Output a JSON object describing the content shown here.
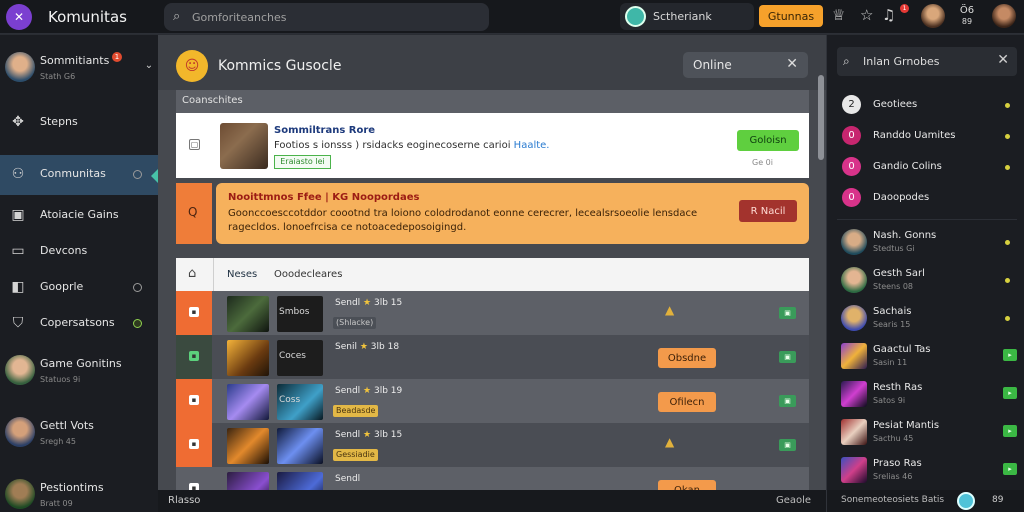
{
  "app": {
    "name": "Komunitas"
  },
  "topbar": {
    "search_placeholder": "Gomforiteanches",
    "user_name": "Sctheriank",
    "primary_button": "Gtunnas",
    "notif_count": "1",
    "coins_top": "Ö6",
    "coins_bottom": "89"
  },
  "sidebar": {
    "items": [
      {
        "label": "Sommitiants",
        "sub": "Stath G6",
        "badge": "1"
      },
      {
        "label": "Stepns"
      },
      {
        "label": "Conmunitas"
      },
      {
        "label": "Atoiacie Gains"
      },
      {
        "label": "Devcons"
      },
      {
        "label": "Gooprle"
      },
      {
        "label": "Copersatsons"
      },
      {
        "label": "Game Gonitins",
        "sub": "Statuos 9i"
      },
      {
        "label": "Gettl Vots",
        "sub": "Sregh 45"
      },
      {
        "label": "Pestiontims",
        "sub": "Bratt 09"
      }
    ]
  },
  "main": {
    "title": "Kommics Gusocle",
    "online_label": "Online",
    "card_header": "Coanschites",
    "post": {
      "name": "Sommiltrans Rore",
      "desc": "Footios s ionsss )  rsidacks  eoginecoserne carioi",
      "link": "Haalte.",
      "tag": "Eraiasto lei",
      "button": "Goloisn",
      "small": "Ge 0i"
    },
    "alert": {
      "icon": "Q",
      "title": "Nooittmnos Ffee | KG  Noopordaes",
      "line1": "Goonccoesccotddor  coootnd tra  loiono  colodrodanot  eonne  cerecrer, lecealsrsoeolie  lensdace",
      "line2": "ragecldos. lonoefrcisa  ce  notoacedeposoigingd.",
      "button": "R Nacil"
    },
    "table": {
      "col1": "Neses",
      "col2": "Ooodecleares",
      "rows": [
        {
          "game_label": "Smbos",
          "title": "Sendl",
          "id": "3lb 15",
          "tag": "(Shlacke)",
          "action": ""
        },
        {
          "game_label": "Coces",
          "title": "Senil",
          "id": "3lb 18",
          "tag": "",
          "action": "Obsdne"
        },
        {
          "game_label": "Coss",
          "title": "Sendl",
          "id": "3lb 19",
          "tag": "Beadasde",
          "action": "Ofilecn"
        },
        {
          "game_label": "",
          "title": "Sendl",
          "id": "3lb 15",
          "tag": "Gessiadie",
          "action": ""
        },
        {
          "game_label": "",
          "title": "Sendl",
          "id": "",
          "tag": "",
          "action": "Okan"
        }
      ]
    }
  },
  "bottombar": {
    "left": "Rlasso",
    "right1": "Geaole",
    "right2": "Sonemeoteosiets Batis"
  },
  "rightpanel": {
    "search_label": "Inlan Grnobes",
    "groups": [
      {
        "name": "Geotiees",
        "icon": "2"
      },
      {
        "name": "Randdo Uamites",
        "icon": "0"
      },
      {
        "name": "Gandio Colins",
        "icon": "0"
      },
      {
        "name": "Daoopodes",
        "icon": "0"
      }
    ],
    "friends": [
      {
        "name": "Nash. Gonns",
        "sub": "Stedtus Gi"
      },
      {
        "name": "Gesth Sarl",
        "sub": "Steens 08"
      },
      {
        "name": "Sachais",
        "sub": "Searis 15"
      },
      {
        "name": "Gaactul Tas",
        "sub": "Sasin 11"
      },
      {
        "name": "Resth Ras",
        "sub": "Satos 9i"
      },
      {
        "name": "Pesiat Mantis",
        "sub": "Sacthu 45"
      },
      {
        "name": "Praso Ras",
        "sub": "Srelias 46"
      }
    ]
  },
  "colors": {
    "accent_orange": "#f6a12b",
    "accent_green": "#5fcf3f",
    "active_blue": "#2f4a63"
  }
}
